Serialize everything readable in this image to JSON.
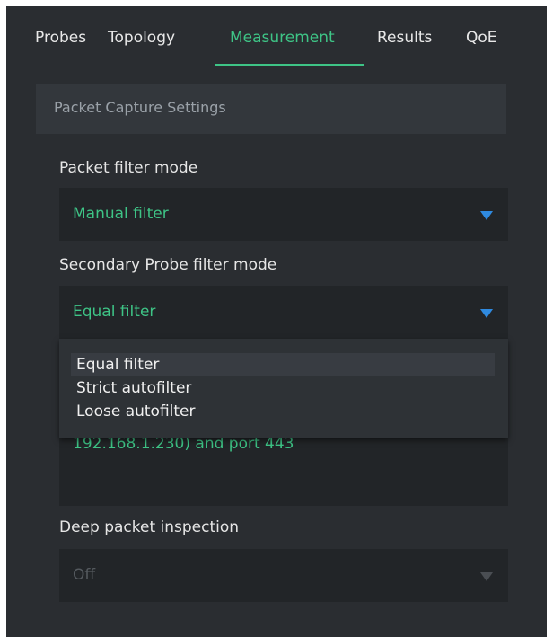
{
  "tabs": [
    {
      "label": "Probes"
    },
    {
      "label": "Topology"
    },
    {
      "label": "Measurement"
    },
    {
      "label": "Results"
    },
    {
      "label": "QoE"
    }
  ],
  "active_tab": "Measurement",
  "section": {
    "title": "Packet Capture Settings"
  },
  "packet_filter": {
    "label": "Packet filter mode",
    "value": "Manual filter"
  },
  "secondary_filter": {
    "label": "Secondary Probe filter mode",
    "value": "Equal filter",
    "options": [
      "Equal filter",
      "Strict autofilter",
      "Loose autofilter"
    ],
    "highlighted": "Equal filter"
  },
  "filter_expression": {
    "visible_text": "192.168.1.230) and port 443"
  },
  "dpi": {
    "label": "Deep packet inspection",
    "value": "Off"
  },
  "colors": {
    "accent": "#3ec486",
    "caret": "#2f8ae0",
    "background": "#2a2d31",
    "field": "#222528"
  },
  "icons": {
    "dropdown": "caret-down-icon"
  }
}
